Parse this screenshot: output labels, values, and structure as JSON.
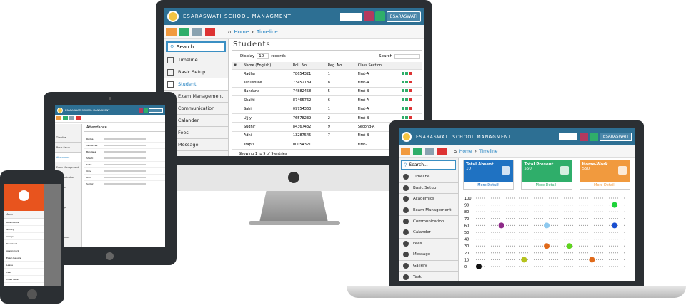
{
  "monitor": {
    "app_title": "ESARASWATI SCHOOL MANAGMENT",
    "user": "ESARASWATI",
    "breadcrumb": {
      "home": "Home",
      "current": "Timeline"
    },
    "search_placeholder": "Search...",
    "sidebar": [
      "Timeline",
      "Basic Setup",
      "Student",
      "Exam Management",
      "Communication",
      "Calander",
      "Fees",
      "Message"
    ],
    "active_index": 2,
    "page_title": "Students",
    "display_label": "Display",
    "display_value": "10",
    "records_label": "records",
    "search_label": "Search",
    "columns": [
      "#",
      "Name (English)",
      "Roll. No.",
      "Reg. No.",
      "Class Section"
    ],
    "rows": [
      [
        "",
        "Radha",
        "78654321",
        "1",
        "First-A"
      ],
      [
        "",
        "Tanushree",
        "73452189",
        "8",
        "First-A"
      ],
      [
        "",
        "Bandana",
        "74882458",
        "5",
        "First-B"
      ],
      [
        "",
        "Shakti",
        "87465762",
        "6",
        "First-A"
      ],
      [
        "",
        "Sahil",
        "09754363",
        "1",
        "First-A"
      ],
      [
        "",
        "Ujjiy",
        "76578239",
        "2",
        "First-B"
      ],
      [
        "",
        "Sudhir",
        "84367432",
        "9",
        "Second-A"
      ],
      [
        "",
        "Adhi",
        "13287545",
        "7",
        "First-B"
      ],
      [
        "",
        "Trapti",
        "00054321",
        "1",
        "First-C"
      ]
    ],
    "footer": "Showing 1 to 9 of 9 entries"
  },
  "laptop": {
    "app_title": "ESARASWATI SCHOOL MANAGMENT",
    "user": "ESARASWATI",
    "breadcrumb": {
      "home": "Home",
      "current": "Timeline"
    },
    "search_placeholder": "Search...",
    "sidebar": [
      "Timeline",
      "Basic Setup",
      "Academics",
      "Exam Management",
      "Communication",
      "Calander",
      "Fees",
      "Message",
      "Gallery",
      "Task"
    ],
    "cards": [
      {
        "title": "Total Absent",
        "value": "10",
        "more": "More Detail!",
        "color": "#1f72c2"
      },
      {
        "title": "Total Present",
        "value": "550",
        "more": "More Detail!",
        "color": "#2fae6a"
      },
      {
        "title": "Home-Work",
        "value": "550",
        "more": "More Detail!",
        "color": "#f19a3e"
      }
    ],
    "chart_data": {
      "type": "scatter",
      "y_ticks": [
        "100",
        "90",
        "80",
        "70",
        "60",
        "50",
        "40",
        "30",
        "20",
        "10",
        "0"
      ],
      "ylim": [
        0,
        100
      ],
      "points": [
        {
          "x": 0,
          "y": 0,
          "color": "#111111"
        },
        {
          "x": 1,
          "y": 60,
          "color": "#8e2a88"
        },
        {
          "x": 2,
          "y": 10,
          "color": "#b5c21c"
        },
        {
          "x": 3,
          "y": 60,
          "color": "#8ec9ef"
        },
        {
          "x": 3,
          "y": 30,
          "color": "#e06a1a"
        },
        {
          "x": 4,
          "y": 30,
          "color": "#5fd41e"
        },
        {
          "x": 5,
          "y": 10,
          "color": "#e06a1a"
        },
        {
          "x": 6,
          "y": 90,
          "color": "#1ed33a"
        },
        {
          "x": 6,
          "y": 60,
          "color": "#1a4fd1"
        }
      ]
    }
  },
  "tablet": {
    "app_title": "ESARASWATI SCHOOL MANAGMENT",
    "page_title": "Attendance",
    "sidebar": [
      "Timeline",
      "Basic Setup",
      "Attendance",
      "Exam Management",
      "Communication",
      "Calander",
      "Fees",
      "Message",
      "Gallery",
      "Task",
      "Attendance"
    ],
    "rows": [
      "Radha",
      "Tanushree",
      "Bandana",
      "Shakti",
      "Sahil",
      "Ujjiy",
      "Adhi",
      "Sudhir"
    ]
  },
  "phone": {
    "menu_label": "Menu",
    "items": [
      "Attendance",
      "Gallery",
      "Assign",
      "Download",
      "Assignment",
      "Exam Results",
      "Leave",
      "Fees",
      "Class Table",
      "Admit Card"
    ]
  }
}
